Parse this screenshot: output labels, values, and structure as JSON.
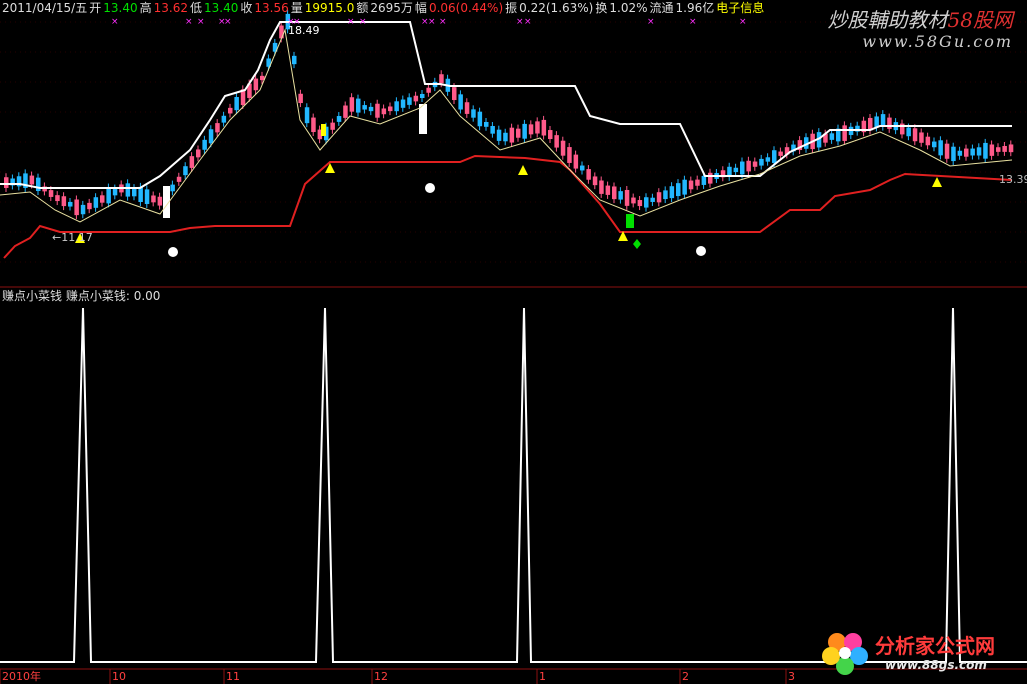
{
  "header": {
    "date": "2011/04/15/五",
    "open_label": "开",
    "open": "13.40",
    "high_label": "高",
    "high": "13.62",
    "low_label": "低",
    "low": "13.40",
    "close_label": "收",
    "close": "13.56",
    "volume_label": "量",
    "volume": "19915.0",
    "amount_label": "额",
    "amount": "2695万",
    "change_label": "幅",
    "change": "0.06(0.44%)",
    "amplitude_label": "振",
    "amplitude": "0.22(1.63%)",
    "turnover_label": "换",
    "turnover": "1.02%",
    "float_label": "流通",
    "float": "1.96亿",
    "info_label": "电子信息"
  },
  "watermark": {
    "text": "炒股輔助教材",
    "brand": "58股网",
    "url": "www.58Gu.com"
  },
  "price_labels": {
    "peak": "18.49",
    "right": "13.39",
    "low": "11.17"
  },
  "sub_panel": {
    "title": "赚点小菜钱",
    "indicator": "赚点小菜钱: 0.00"
  },
  "x_axis": [
    "2010年",
    "10",
    "11",
    "12",
    "1",
    "2",
    "3"
  ],
  "logo": {
    "name": "分析家公式网",
    "url": "www.88gs.com"
  },
  "colors": {
    "up": "#ff5a8a",
    "down": "#22b8ff",
    "upper_band": "#ffffff",
    "lower_band": "#e02020",
    "signal": "#ffff00",
    "grid": "#8b1010"
  }
}
